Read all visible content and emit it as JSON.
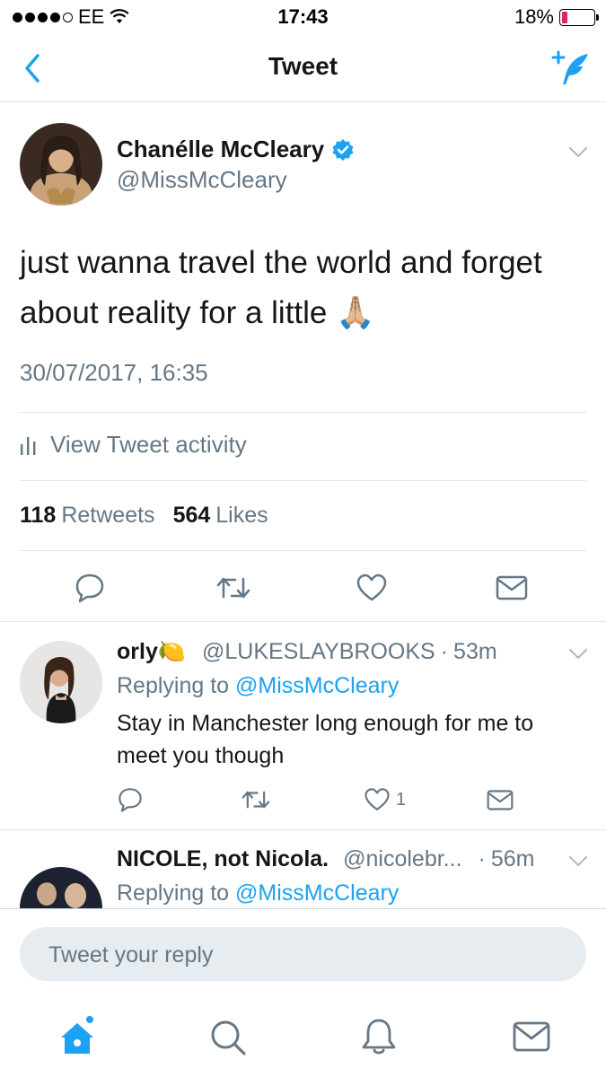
{
  "status_bar": {
    "carrier": "EE",
    "time": "17:43",
    "battery": "18%",
    "battery_level": 0.18
  },
  "nav": {
    "title": "Tweet"
  },
  "tweet": {
    "author_name": "Chanélle McCleary",
    "author_handle": "@MissMcCleary",
    "verified": true,
    "text": "just wanna travel the world and forget about reality for a little 🙏🏼",
    "date": "30/07/2017, 16:35",
    "activity_label": "View Tweet activity",
    "retweets_count": "118",
    "retweets_label": "Retweets",
    "likes_count": "564",
    "likes_label": "Likes"
  },
  "replies": [
    {
      "name": "orly🍋",
      "handle": "@LUKESLAYBROOKS",
      "time": "53m",
      "replying_prefix": "Replying to",
      "replying_to": "@MissMcCleary",
      "text": "Stay in Manchester long enough for me to meet you though",
      "likes": "1"
    },
    {
      "name": "NICOLE, not Nicola.",
      "handle": "@nicolebr...",
      "time": "56m",
      "replying_prefix": "Replying to",
      "replying_to": "@MissMcCleary"
    }
  ],
  "composer": {
    "placeholder": "Tweet your reply"
  },
  "colors": {
    "accent": "#1da1f2",
    "text_secondary": "#657786",
    "divider": "#e1e8ed",
    "battery_low": "#e0245e"
  },
  "icons": [
    "back-icon",
    "compose-icon",
    "verified-icon",
    "chevron-down-icon",
    "stats-icon",
    "reply-icon",
    "retweet-icon",
    "like-icon",
    "dm-icon",
    "home-icon",
    "search-icon",
    "notifications-icon",
    "messages-icon"
  ]
}
